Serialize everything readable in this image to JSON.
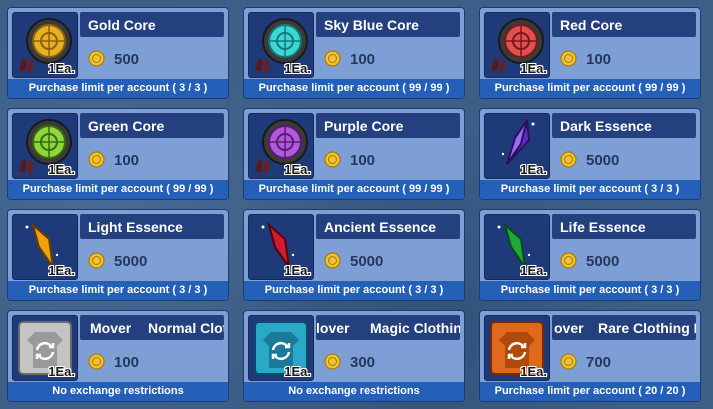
{
  "items": [
    {
      "name": "Gold Core",
      "qty": "1Ea.",
      "price": "500",
      "limit": "Purchase limit per account ( 3 / 3 )",
      "icon": "gold-core-icon",
      "color": "#e8b020"
    },
    {
      "name": "Sky Blue Core",
      "qty": "1Ea.",
      "price": "100",
      "limit": "Purchase limit per account ( 99 / 99 )",
      "icon": "sky-blue-core-icon",
      "color": "#3fd6d6"
    },
    {
      "name": "Red Core",
      "qty": "1Ea.",
      "price": "100",
      "limit": "Purchase limit per account ( 99 / 99 )",
      "icon": "red-core-icon",
      "color": "#e05050"
    },
    {
      "name": "Green Core",
      "qty": "1Ea.",
      "price": "100",
      "limit": "Purchase limit per account ( 99 / 99 )",
      "icon": "green-core-icon",
      "color": "#8cd83a"
    },
    {
      "name": "Purple Core",
      "qty": "1Ea.",
      "price": "100",
      "limit": "Purchase limit per account ( 99 / 99 )",
      "icon": "purple-core-icon",
      "color": "#b05ad8"
    },
    {
      "name": "Dark Essence",
      "qty": "1Ea.",
      "price": "5000",
      "limit": "Purchase limit per account ( 3 / 3 )",
      "icon": "dark-essence-icon",
      "color": "#7a4fe0"
    },
    {
      "name": "Light Essence",
      "qty": "1Ea.",
      "price": "5000",
      "limit": "Purchase limit per account ( 3 / 3 )",
      "icon": "light-essence-icon",
      "color": "#f5b21c"
    },
    {
      "name": "Ancient Essence",
      "qty": "1Ea.",
      "price": "5000",
      "limit": "Purchase limit per account ( 3 / 3 )",
      "icon": "ancient-essence-icon",
      "color": "#e0303c"
    },
    {
      "name": "Life Essence",
      "qty": "1Ea.",
      "price": "5000",
      "limit": "Purchase limit per account ( 3 / 3 )",
      "icon": "life-essence-icon",
      "color": "#2fc04a"
    },
    {
      "name_parts": [
        "Mover",
        "Normal Cloth"
      ],
      "qty": "1Ea.",
      "price": "100",
      "limit": "No exchange restrictions",
      "icon": "normal-clothing-icon",
      "color": "#c0c0c0"
    },
    {
      "name_parts": [
        "lover",
        "Magic Clothin"
      ],
      "qty": "1Ea.",
      "price": "300",
      "limit": "No exchange restrictions",
      "icon": "magic-clothing-icon",
      "color": "#2aa8c8"
    },
    {
      "name_parts": [
        "over",
        "Rare Clothing I"
      ],
      "qty": "1Ea.",
      "price": "700",
      "limit": "Purchase limit per account ( 20 / 20 )",
      "icon": "rare-clothing-icon",
      "color": "#e06a1c"
    }
  ],
  "colors": {
    "coin": "#f2c230",
    "footer": "#2460b8",
    "name_bar": "#25407e",
    "card": "#7d9fd6"
  }
}
